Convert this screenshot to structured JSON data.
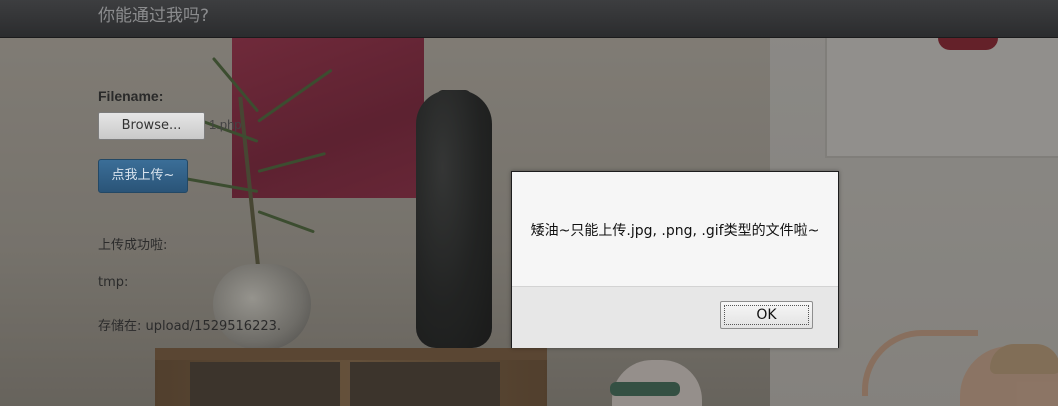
{
  "navbar": {
    "title": "你能通过我吗?"
  },
  "upload_form": {
    "file_label": "Filename:",
    "browse_button": "Browse...",
    "selected_file": "1.php",
    "submit_button": "点我上传~"
  },
  "results": {
    "success_label": "上传成功啦:",
    "tmp_label": "tmp:",
    "stored_label": "存储在: upload/1529516223."
  },
  "alert_dialog": {
    "message": "矮油~只能上传.jpg, .png, .gif类型的文件啦~",
    "ok_button": "OK"
  },
  "colors": {
    "navbar_bg": "#2b2c2e",
    "primary_button": "#2a5478",
    "dialog_bg": "#f6f6f6"
  }
}
